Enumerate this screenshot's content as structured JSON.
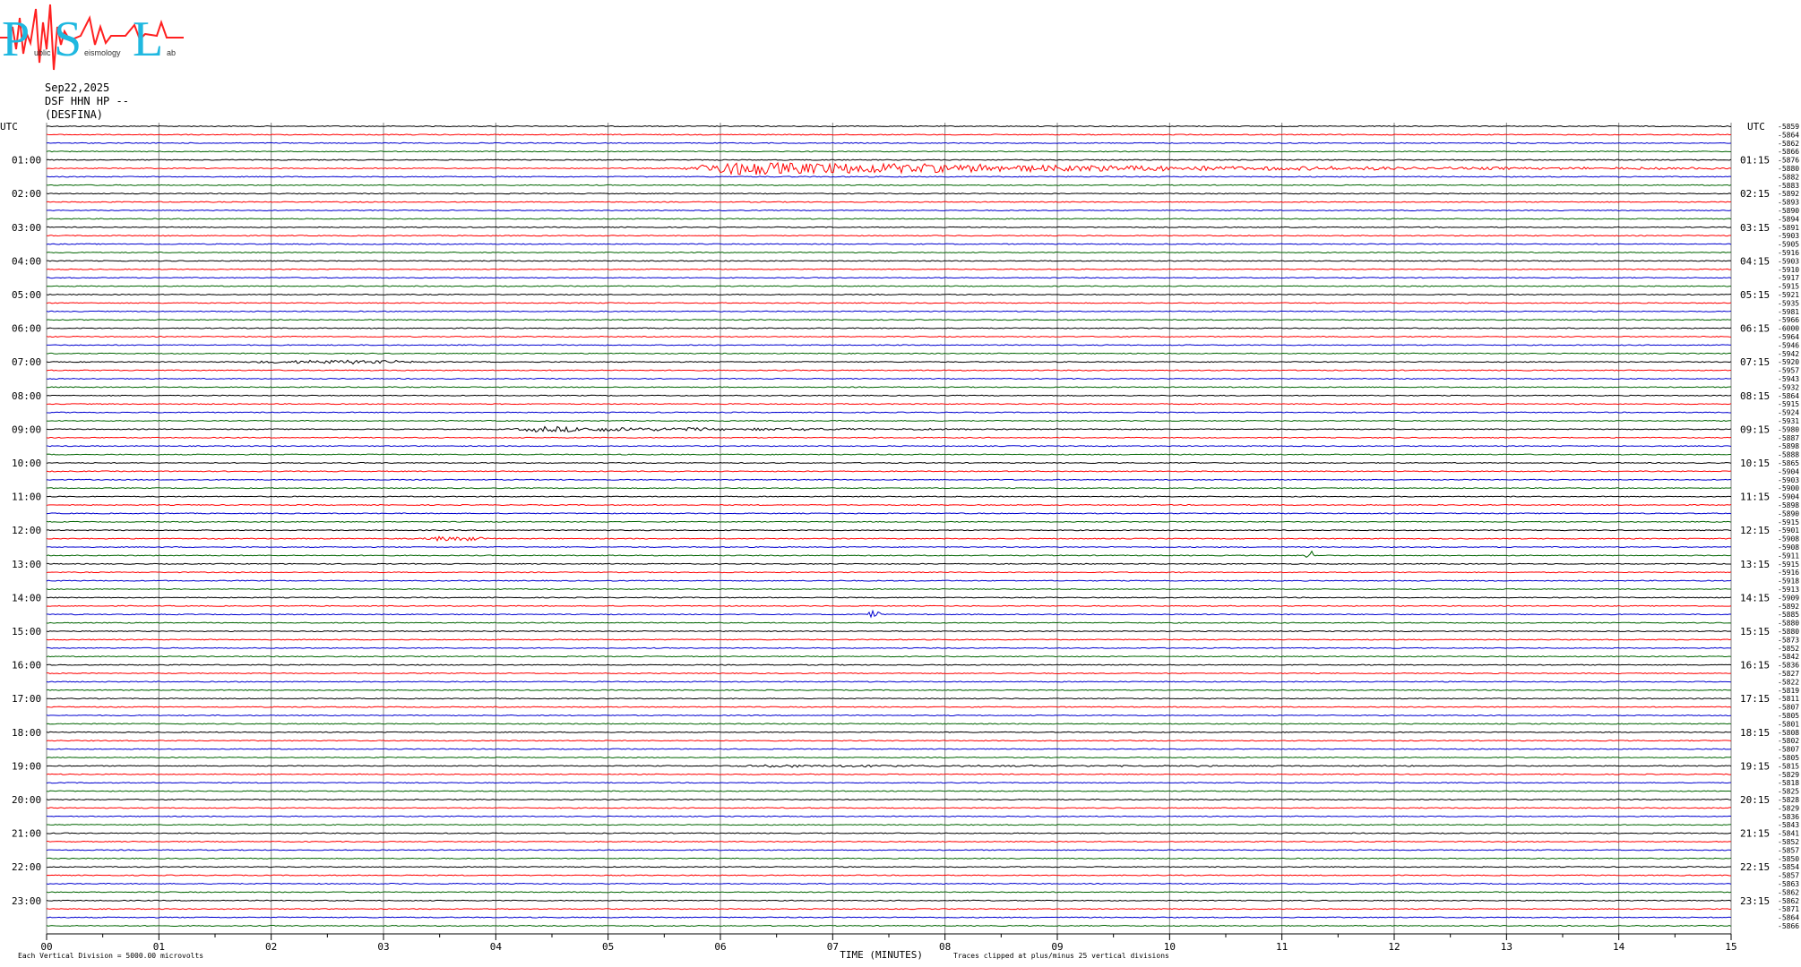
{
  "logo": {
    "big_letters": [
      "P",
      "S",
      "L"
    ],
    "small_text": [
      "ublic",
      "eismology",
      "ab"
    ]
  },
  "header": {
    "date": "Sep22,2025",
    "station": "DSF HHN HP --",
    "site": "(DESFINA)"
  },
  "colors": {
    "black": "#000000",
    "red": "#ff0000",
    "blue": "#0000d0",
    "green": "#006400",
    "grid": "#808080",
    "logo_cyan": "#1fb8e0",
    "logo_red": "#ff2020"
  },
  "chart_data": {
    "type": "line",
    "description_units": "helicorder: 96 traces of 15 minutes each",
    "left_axis_title": "UTC",
    "right_axis_title": "UTC",
    "left_hour_labels": [
      "01:00",
      "02:00",
      "03:00",
      "04:00",
      "05:00",
      "06:00",
      "07:00",
      "08:00",
      "09:00",
      "10:00",
      "11:00",
      "12:00",
      "13:00",
      "14:00",
      "15:00",
      "16:00",
      "17:00",
      "18:00",
      "19:00",
      "20:00",
      "21:00",
      "22:00",
      "23:00"
    ],
    "right_labels": [
      "01:15",
      "02:15",
      "03:15",
      "04:15",
      "05:15",
      "06:15",
      "07:15",
      "08:15",
      "09:15",
      "10:15",
      "11:15",
      "12:15",
      "13:15",
      "14:15",
      "15:15",
      "16:15",
      "17:15",
      "18:15",
      "19:15",
      "20:15",
      "21:15",
      "22:15",
      "23:15"
    ],
    "x_tick_labels": [
      "00",
      "01",
      "02",
      "03",
      "04",
      "05",
      "06",
      "07",
      "08",
      "09",
      "10",
      "11",
      "12",
      "13",
      "14",
      "15"
    ],
    "xlabel": "TIME (MINUTES)",
    "xlim": [
      0,
      15
    ],
    "trace_count": 96,
    "trace_colors_cycle": [
      "black",
      "red",
      "blue",
      "green"
    ],
    "trace_offsets": [
      "-5859",
      "-5864",
      "-5862",
      "-5866",
      "-5876",
      "-5880",
      "-5882",
      "-5883",
      "-5892",
      "-5893",
      "-5890",
      "-5894",
      "-5891",
      "-5903",
      "-5905",
      "-5916",
      "-5903",
      "-5910",
      "-5917",
      "-5915",
      "-5921",
      "-5935",
      "-5981",
      "-5966",
      "-6000",
      "-5964",
      "-5946",
      "-5942",
      "-5920",
      "-5957",
      "-5943",
      "-5932",
      "-5864",
      "-5915",
      "-5924",
      "-5931",
      "-5980",
      "-5887",
      "-5898",
      "-5888",
      "-5865",
      "-5904",
      "-5903",
      "-5900",
      "-5904",
      "-5898",
      "-5890",
      "-5915",
      "-5901",
      "-5908",
      "-5908",
      "-5911",
      "-5915",
      "-5916",
      "-5918",
      "-5913",
      "-5909",
      "-5892",
      "-5885",
      "-5880",
      "-5880",
      "-5873",
      "-5852",
      "-5842",
      "-5836",
      "-5827",
      "-5822",
      "-5819",
      "-5811",
      "-5807",
      "-5805",
      "-5801",
      "-5808",
      "-5802",
      "-5807",
      "-5805",
      "-5815",
      "-5829",
      "-5818",
      "-5825",
      "-5828",
      "-5829",
      "-5836",
      "-5843",
      "-5841",
      "-5852",
      "-5857",
      "-5850",
      "-5854",
      "-5857",
      "-5863",
      "-5862",
      "-5862",
      "-5871",
      "-5864",
      "-5866"
    ],
    "events": [
      {
        "trace": 5,
        "start_min": 5.6,
        "end_min": 15,
        "peak_amp_div": 0.9,
        "label": ""
      },
      {
        "trace": 36,
        "start_min": 4.1,
        "end_min": 9.8,
        "peak_amp_div": 0.35,
        "label": ""
      },
      {
        "trace": 49,
        "start_min": 3.3,
        "end_min": 4.0,
        "peak_amp_div": 0.3,
        "label": ""
      },
      {
        "trace": 51,
        "start_min": 11.2,
        "end_min": 11.3,
        "peak_amp_div": 0.6,
        "label": ""
      },
      {
        "trace": 58,
        "start_min": 7.3,
        "end_min": 7.45,
        "peak_amp_div": 0.5,
        "label": ""
      },
      {
        "trace": 28,
        "start_min": 1.6,
        "end_min": 3.6,
        "peak_amp_div": 0.2,
        "label": ""
      },
      {
        "trace": 76,
        "start_min": 6.0,
        "end_min": 15,
        "peak_amp_div": 0.15,
        "label": ""
      }
    ],
    "footer_left": "Each Vertical Division = 5000.00 microvolts",
    "footer_right": "Traces clipped at plus/minus 25 vertical divisions"
  }
}
